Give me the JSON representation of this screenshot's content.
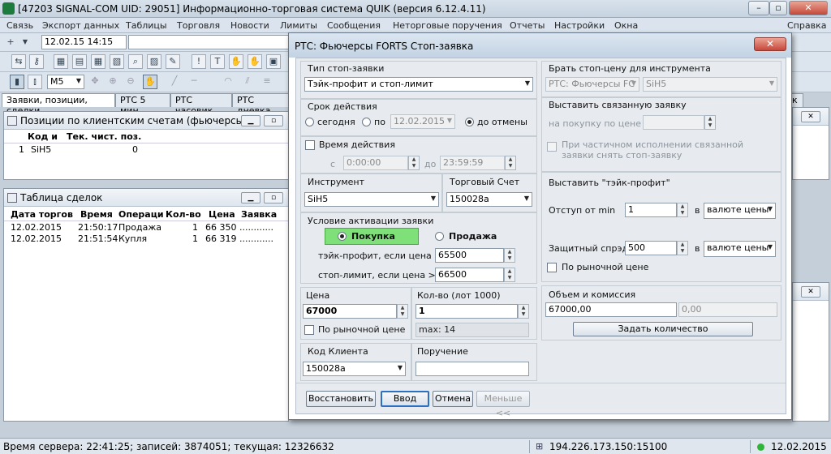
{
  "window": {
    "title": "[47203  SIGNAL-COM UID: 29051] Информационно-торговая система QUIK (версия 6.12.4.11)"
  },
  "menu": [
    "Связь",
    "Экспорт данных",
    "Таблицы",
    "Торговля",
    "Новости",
    "Лимиты",
    "Сообщения",
    "Неторговые поручения",
    "Отчеты",
    "Настройки",
    "Окна",
    "Справка"
  ],
  "toolbar": {
    "datetime": "12.02.15 14:15",
    "interval": "M5"
  },
  "tabs": [
    "Заявки, позиции, сделки",
    "РТС 5 мин.",
    "РТС часовик",
    "РТС дневка",
    "к"
  ],
  "positions": {
    "title": "Позиции по клиентским счетам (фьючерсы)",
    "headers": [
      "Код и",
      "Тек. чист. поз."
    ],
    "rows": [
      {
        "n": "1",
        "code": "SiH5",
        "pos": "0"
      }
    ]
  },
  "trades": {
    "title": "Таблица сделок",
    "headers": [
      "Дата торгов",
      "Время",
      "Операци",
      "Кол-во",
      "Цена",
      "Заявка"
    ],
    "rows": [
      {
        "date": "12.02.2015",
        "time": "21:50:17",
        "op": "Продажа",
        "qty": "1",
        "price": "66 350",
        "order": "............"
      },
      {
        "date": "12.02.2015",
        "time": "21:51:54",
        "op": "Купля",
        "qty": "1",
        "price": "66 319",
        "order": "............"
      }
    ]
  },
  "dialog": {
    "title": "РТС: Фьючерсы FORTS Стоп-заявка",
    "stop_type": {
      "label": "Тип стоп-заявки",
      "value": "Тэйк-профит и стоп-лимит"
    },
    "validity": {
      "label": "Срок действия",
      "today": "сегодня",
      "until": "по",
      "date": "12.02.2015",
      "cancel": "до отмены"
    },
    "active_time": {
      "label": "Время действия",
      "from": "с",
      "from_val": "0:00:00",
      "to": "до",
      "to_val": "23:59:59"
    },
    "instrument": {
      "label": "Инструмент",
      "value": "SiH5"
    },
    "account": {
      "label": "Торговый Счет",
      "value": "150028a"
    },
    "condition": {
      "label": "Условие активации заявки",
      "buy": "Покупка",
      "sell": "Продажа",
      "tp_label": "тэйк-профит, если цена <=",
      "tp_val": "65500",
      "sl_label": "стоп-лимит, если цена >=",
      "sl_val": "66500"
    },
    "price": {
      "label": "Цена",
      "value": "67000",
      "market": "По рыночной цене"
    },
    "qty": {
      "label": "Кол-во (лот 1000)",
      "value": "1",
      "max": "max: 14"
    },
    "client": {
      "label": "Код Клиента",
      "value": "150028a"
    },
    "instruction": {
      "label": "Поручение",
      "value": ""
    },
    "right": {
      "take_stop_label": "Брать стоп-цену для инструмента",
      "class_val": "РТС: Фьючерсы FC",
      "sec_val": "SiH5",
      "linked_label": "Выставить связанную заявку",
      "linked_buy": "на покупку по цене",
      "linked_partial": "При частичном исполнении связанной заявки снять стоп-заявку",
      "tp_label": "Выставить \"тэйк-профит\"",
      "offset_label": "Отступ от min",
      "offset_val": "1",
      "in1": "в",
      "unit1": "валюте цены",
      "spread_label": "Защитный спрэд",
      "spread_val": "500",
      "in2": "в",
      "unit2": "валюте цены",
      "market": "По рыночной цене",
      "volume_label": "Объем и комиссия",
      "volume_val": "67000,00",
      "commission_val": "0,00",
      "set_qty": "Задать количество"
    },
    "buttons": {
      "restore": "Восстановить",
      "enter": "Ввод",
      "cancel": "Отмена",
      "less": "Меньше <<"
    }
  },
  "status": {
    "server": "Время сервера: 22:41:25; записей: 3874051; текущая: 12326632",
    "ip": "194.226.173.150:15100",
    "date": "12.02.2015"
  }
}
